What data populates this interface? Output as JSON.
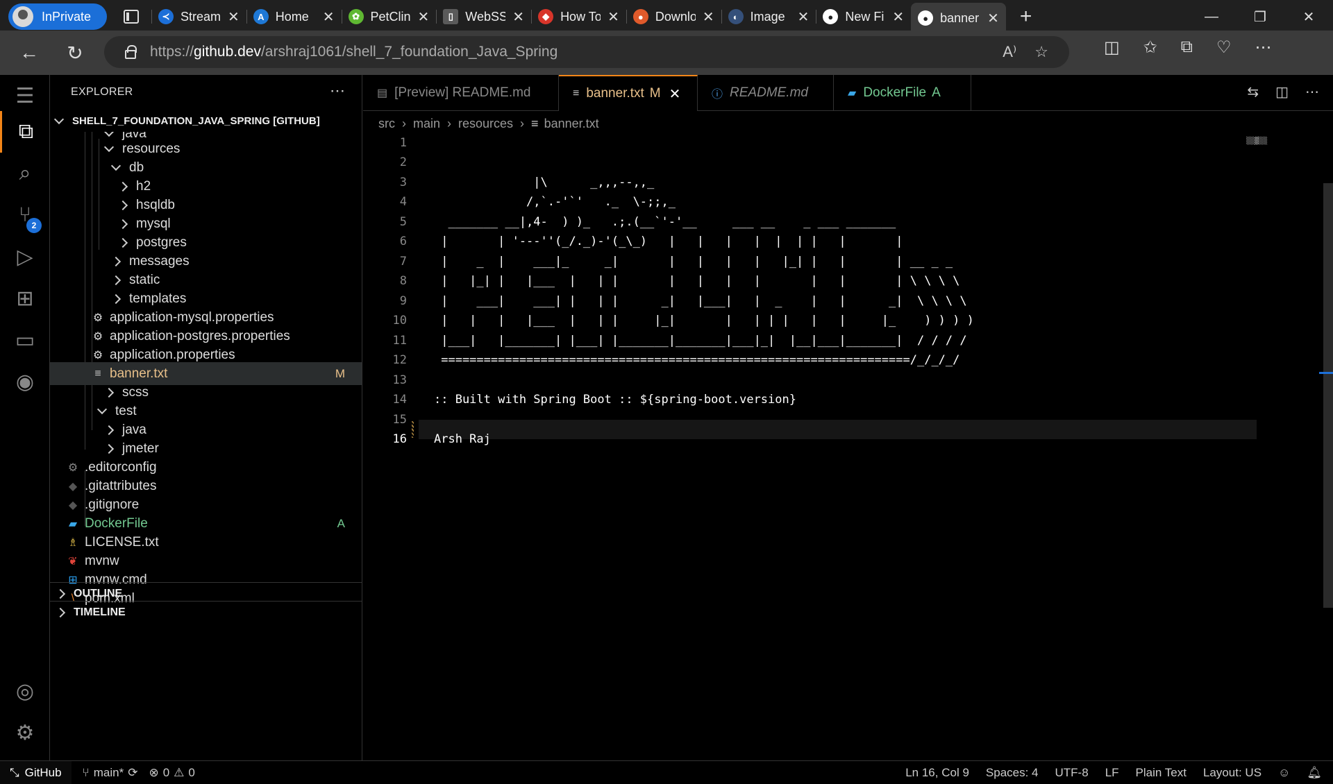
{
  "browser": {
    "inprivate_label": "InPrivate",
    "tabs": [
      {
        "title": "Stream",
        "color": "#1c6fd8",
        "glyph": "≺"
      },
      {
        "title": "Home",
        "color": "#1e78d6",
        "glyph": "A"
      },
      {
        "title": "PetClin",
        "color": "#5fb832",
        "glyph": "✿"
      },
      {
        "title": "WebSS",
        "color": "#5a5a5a",
        "glyph": "▯"
      },
      {
        "title": "How To",
        "color": "#d8352a",
        "glyph": "◆"
      },
      {
        "title": "Downlo",
        "color": "#e05a2b",
        "glyph": "●"
      },
      {
        "title": "Image",
        "color": "#35507a",
        "glyph": "◐"
      },
      {
        "title": "New Fi",
        "color": "#222222",
        "glyph": "●"
      },
      {
        "title": "banner",
        "color": "#222222",
        "glyph": "●"
      }
    ],
    "url_prefix": "https://",
    "url_host": "github.dev",
    "url_path": "/arshraj1061/shell_7_foundation_Java_Spring"
  },
  "explorer": {
    "title": "EXPLORER",
    "root": "SHELL_7_FOUNDATION_JAVA_SPRING [GITHUB]",
    "items": [
      {
        "label": "java"
      },
      {
        "label": "resources"
      },
      {
        "label": "db"
      },
      {
        "label": "h2"
      },
      {
        "label": "hsqldb"
      },
      {
        "label": "mysql"
      },
      {
        "label": "postgres"
      },
      {
        "label": "messages"
      },
      {
        "label": "static"
      },
      {
        "label": "templates"
      },
      {
        "label": "application-mysql.properties"
      },
      {
        "label": "application-postgres.properties"
      },
      {
        "label": "application.properties"
      },
      {
        "label": "banner.txt",
        "status": "M"
      },
      {
        "label": "scss"
      },
      {
        "label": "test"
      },
      {
        "label": "java"
      },
      {
        "label": "jmeter"
      },
      {
        "label": ".editorconfig"
      },
      {
        "label": ".gitattributes"
      },
      {
        "label": ".gitignore"
      },
      {
        "label": "DockerFile",
        "status": "A"
      },
      {
        "label": "LICENSE.txt"
      },
      {
        "label": "mvnw"
      },
      {
        "label": "mvnw.cmd"
      },
      {
        "label": "pom.xml"
      }
    ],
    "outline": "OUTLINE",
    "timeline": "TIMELINE"
  },
  "activity": {
    "scm_badge": "2"
  },
  "editor": {
    "tabs": [
      {
        "label": "[Preview] README.md"
      },
      {
        "label": "banner.txt",
        "status": "M"
      },
      {
        "label": "README.md"
      },
      {
        "label": "DockerFile",
        "status": "A"
      }
    ],
    "breadcrumbs": [
      "src",
      "main",
      "resources",
      "banner.txt"
    ],
    "lines": [
      "",
      "",
      "              |\\      _,,,--,,_",
      "             /,`.-'`'   ._  \\-;;,_",
      "  _______ __|,4-  ) )_   .;.(__`'-'__     ___ __    _ ___ _______",
      " |       | '---''(_/._)-'(_\\_)   |   |   |   |  |  | |   |       |",
      " |    _  |    ___|_     _|       |   |   |   |   |_| |   |       | __ _ _",
      " |   |_| |   |___  |   | |       |   |   |   |       |   |       | \\ \\ \\ \\",
      " |    ___|    ___| |   | |      _|   |___|   |  _    |   |      _|  \\ \\ \\ \\",
      " |   |   |   |___  |   | |     |_|       |   | | |   |   |     |_    ) ) ) )",
      " |___|   |_______| |___| |_______|_______|___|_|  |__|___|_______|  / / / /",
      " ==================================================================/_/_/_/",
      "",
      ":: Built with Spring Boot :: ${spring-boot.version}",
      "",
      "Arsh Raj"
    ],
    "current_line": 16
  },
  "status": {
    "remote": "GitHub",
    "branch": "main*",
    "errors": "0",
    "warnings": "0",
    "position": "Ln 16, Col 9",
    "spaces": "Spaces: 4",
    "encoding": "UTF-8",
    "eol": "LF",
    "language": "Plain Text",
    "layout": "Layout: US"
  }
}
